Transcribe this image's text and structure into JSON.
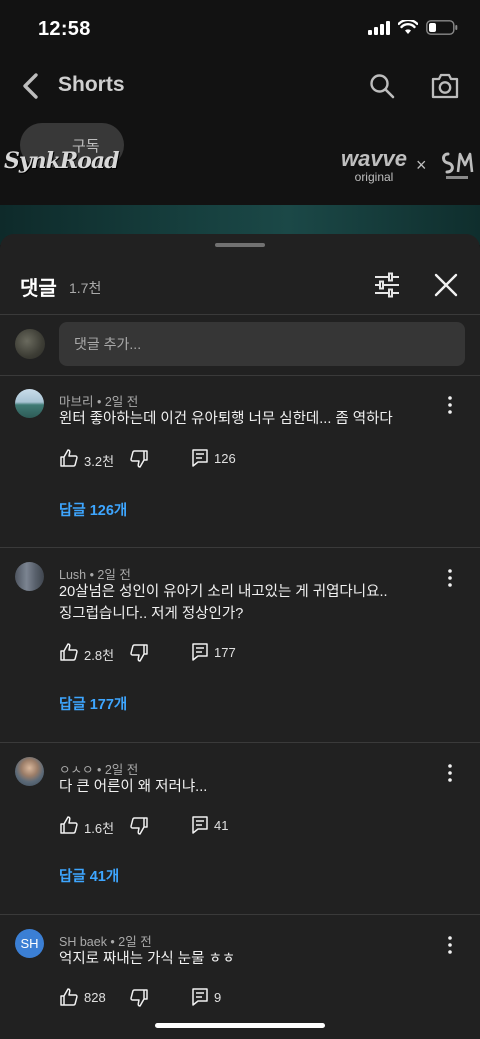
{
  "status_bar": {
    "time": "12:58"
  },
  "topbar": {
    "title": "Shorts"
  },
  "video": {
    "subscribe_label": "구독",
    "channel_logo_text": "SynkRoad",
    "partner_logo_text": "wavve",
    "partner_logo_sub": "original",
    "cross_symbol": "×"
  },
  "sheet": {
    "title": "댓글",
    "count": "1.7천",
    "add_comment_placeholder": "댓글 추가..."
  },
  "comments": [
    {
      "author": "마브리 • 2일 전",
      "lines": [
        "윈터 좋아하는데 이건 유아퇴행 너무 심한데... 좀 역하다"
      ],
      "likes": "3.2천",
      "reply_count": "126",
      "replies_label": "답글 126개"
    },
    {
      "author": "Lush • 2일 전",
      "lines": [
        "20살넘은 성인이 유아기 소리 내고있는 게 귀엽다니요..",
        "징그럽습니다.. 저게 정상인가?"
      ],
      "likes": "2.8천",
      "reply_count": "177",
      "replies_label": "답글 177개"
    },
    {
      "author": "ㅇㅅㅇ • 2일 전",
      "lines": [
        "다 큰 어른이 왜 저러냐..."
      ],
      "likes": "1.6천",
      "reply_count": "41",
      "replies_label": "답글 41개"
    },
    {
      "author": "SH baek • 2일 전",
      "avatar_initials": "SH",
      "lines": [
        "억지로 짜내는 가식 눈물 ㅎㅎ"
      ],
      "likes": "828",
      "reply_count": "9"
    }
  ],
  "colors": {
    "background": "#0f0f0f",
    "sheet": "#212121",
    "link": "#3ea6ff",
    "avatar_sh": "#3b7fd4"
  }
}
